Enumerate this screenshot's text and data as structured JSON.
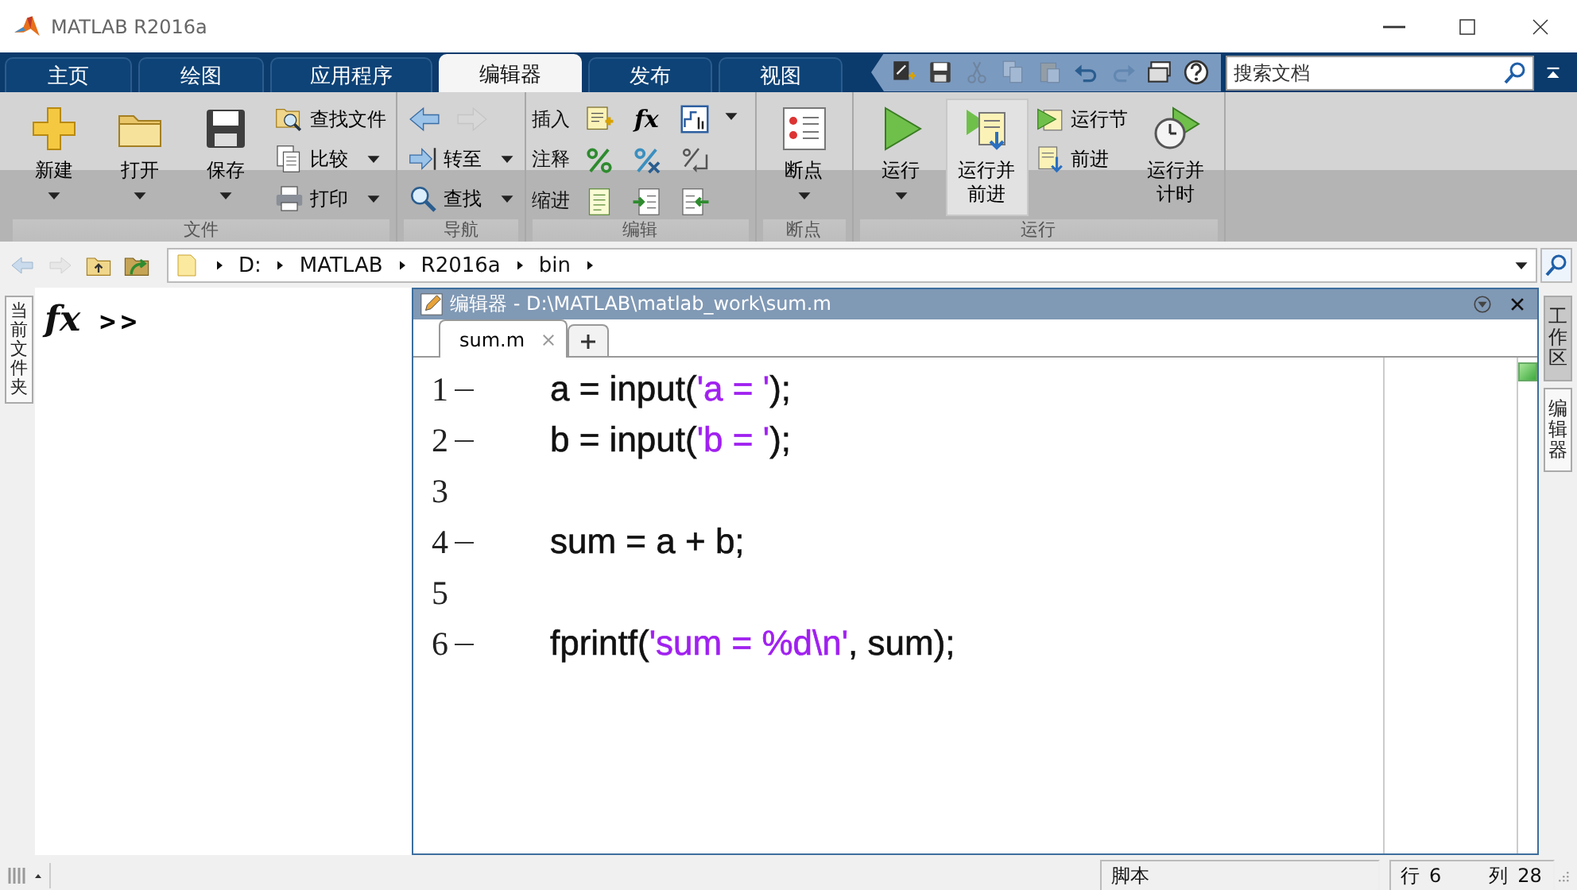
{
  "window": {
    "title": "MATLAB R2016a"
  },
  "tabs": [
    {
      "label": "主页",
      "selected": false
    },
    {
      "label": "绘图",
      "selected": false
    },
    {
      "label": "应用程序",
      "selected": false
    },
    {
      "label": "编辑器",
      "selected": true
    },
    {
      "label": "发布",
      "selected": false
    },
    {
      "label": "视图",
      "selected": false
    }
  ],
  "quick_access": [
    {
      "disabled": false
    },
    {
      "disabled": false
    },
    {
      "disabled": true
    },
    {
      "disabled": true
    },
    {
      "disabled": true
    },
    {
      "disabled": false
    },
    {
      "disabled": true
    },
    {
      "disabled": false
    },
    {
      "disabled": false
    }
  ],
  "search": {
    "placeholder": "搜索文档"
  },
  "ribbon": {
    "groups": [
      {
        "label": "文件",
        "items": [
          {
            "kind": "large",
            "label": "新建",
            "dropdown": true,
            "highlighted": false
          },
          {
            "kind": "large",
            "label": "打开",
            "dropdown": true,
            "highlighted": false
          },
          {
            "kind": "large",
            "label": "保存",
            "dropdown": true,
            "highlighted": false
          },
          {
            "kind": "column",
            "items": [
              {
                "kind": "small",
                "label": "查找文件",
                "dropdown": false
              },
              {
                "kind": "small",
                "label": "比较",
                "dropdown": true
              },
              {
                "kind": "small",
                "label": "打印",
                "dropdown": true
              }
            ]
          }
        ]
      },
      {
        "label": "导航",
        "items": [
          {
            "kind": "column",
            "items": [
              {
                "kind": "icons",
                "buttons": [
                  {
                    "disabled": false
                  },
                  {
                    "disabled": true
                  }
                ]
              },
              {
                "kind": "small",
                "label": "转至",
                "dropdown": true
              },
              {
                "kind": "small",
                "label": "查找",
                "dropdown": true
              }
            ]
          }
        ]
      },
      {
        "label": "编辑",
        "items": [
          {
            "kind": "grid",
            "rows": [
              {
                "label": "插入",
                "dropdown": true,
                "buttons": [
                  {
                    "kind": "icon"
                  },
                  {
                    "kind": "glyph",
                    "text": "fx"
                  },
                  {
                    "kind": "icon"
                  }
                ]
              },
              {
                "label": "注释",
                "dropdown": false,
                "buttons": [
                  {
                    "kind": "icon"
                  },
                  {
                    "kind": "icon"
                  },
                  {
                    "kind": "icon"
                  }
                ]
              },
              {
                "label": "缩进",
                "dropdown": false,
                "buttons": [
                  {
                    "kind": "icon"
                  },
                  {
                    "kind": "icon"
                  },
                  {
                    "kind": "icon"
                  }
                ]
              }
            ]
          }
        ]
      },
      {
        "label": "断点",
        "items": [
          {
            "kind": "large",
            "label": "断点",
            "dropdown": true,
            "highlighted": false
          }
        ]
      },
      {
        "label": "运行",
        "items": [
          {
            "kind": "large",
            "label": "运行",
            "dropdown": true,
            "highlighted": false
          },
          {
            "kind": "large",
            "label": "运行并",
            "label_2": "前进",
            "dropdown": false,
            "highlighted": true
          },
          {
            "kind": "column",
            "items": [
              {
                "kind": "small",
                "label": "运行节",
                "dropdown": false
              },
              {
                "kind": "small",
                "label": "前进",
                "dropdown": false
              }
            ]
          },
          {
            "kind": "large",
            "label": "运行并",
            "label_2": "计时",
            "dropdown": false,
            "highlighted": false
          }
        ]
      }
    ]
  },
  "address_bar": {
    "path": [
      "D:",
      "MATLAB",
      "R2016a",
      "bin"
    ]
  },
  "left_panel": {
    "tab": "当前文件夹"
  },
  "command_window": {
    "fx": "fx",
    "prompt": ">>"
  },
  "editor": {
    "title": "编辑器 - D:\\MATLAB\\matlab_work\\sum.m",
    "tabs": [
      {
        "label": "sum.m",
        "selected": true
      }
    ],
    "lines": [
      {
        "number": "1",
        "executable": true,
        "segments": [
          {
            "kind": "code",
            "text": "a = input("
          },
          {
            "kind": "string",
            "text": "'a = '"
          },
          {
            "kind": "code",
            "text": ");"
          }
        ]
      },
      {
        "number": "2",
        "executable": true,
        "segments": [
          {
            "kind": "code",
            "text": "b = input("
          },
          {
            "kind": "string",
            "text": "'b = '"
          },
          {
            "kind": "code",
            "text": ");"
          }
        ]
      },
      {
        "number": "3",
        "executable": false
      },
      {
        "number": "4",
        "executable": true,
        "segments": [
          {
            "kind": "code",
            "text": "sum = a + b;"
          }
        ]
      },
      {
        "number": "5",
        "executable": false
      },
      {
        "number": "6",
        "executable": true,
        "segments": [
          {
            "kind": "code",
            "text": "fprintf("
          },
          {
            "kind": "string",
            "text": "'sum = %d\\n'"
          },
          {
            "kind": "code",
            "text": ", sum);"
          }
        ]
      }
    ]
  },
  "right_panel": {
    "tabs": [
      {
        "label": "工作区",
        "selected": false
      },
      {
        "label": "编辑器",
        "selected": true
      }
    ]
  },
  "status_bar": {
    "mode": "脚本",
    "line_label": "行",
    "line": "6",
    "col_label": "列",
    "col": "28"
  }
}
